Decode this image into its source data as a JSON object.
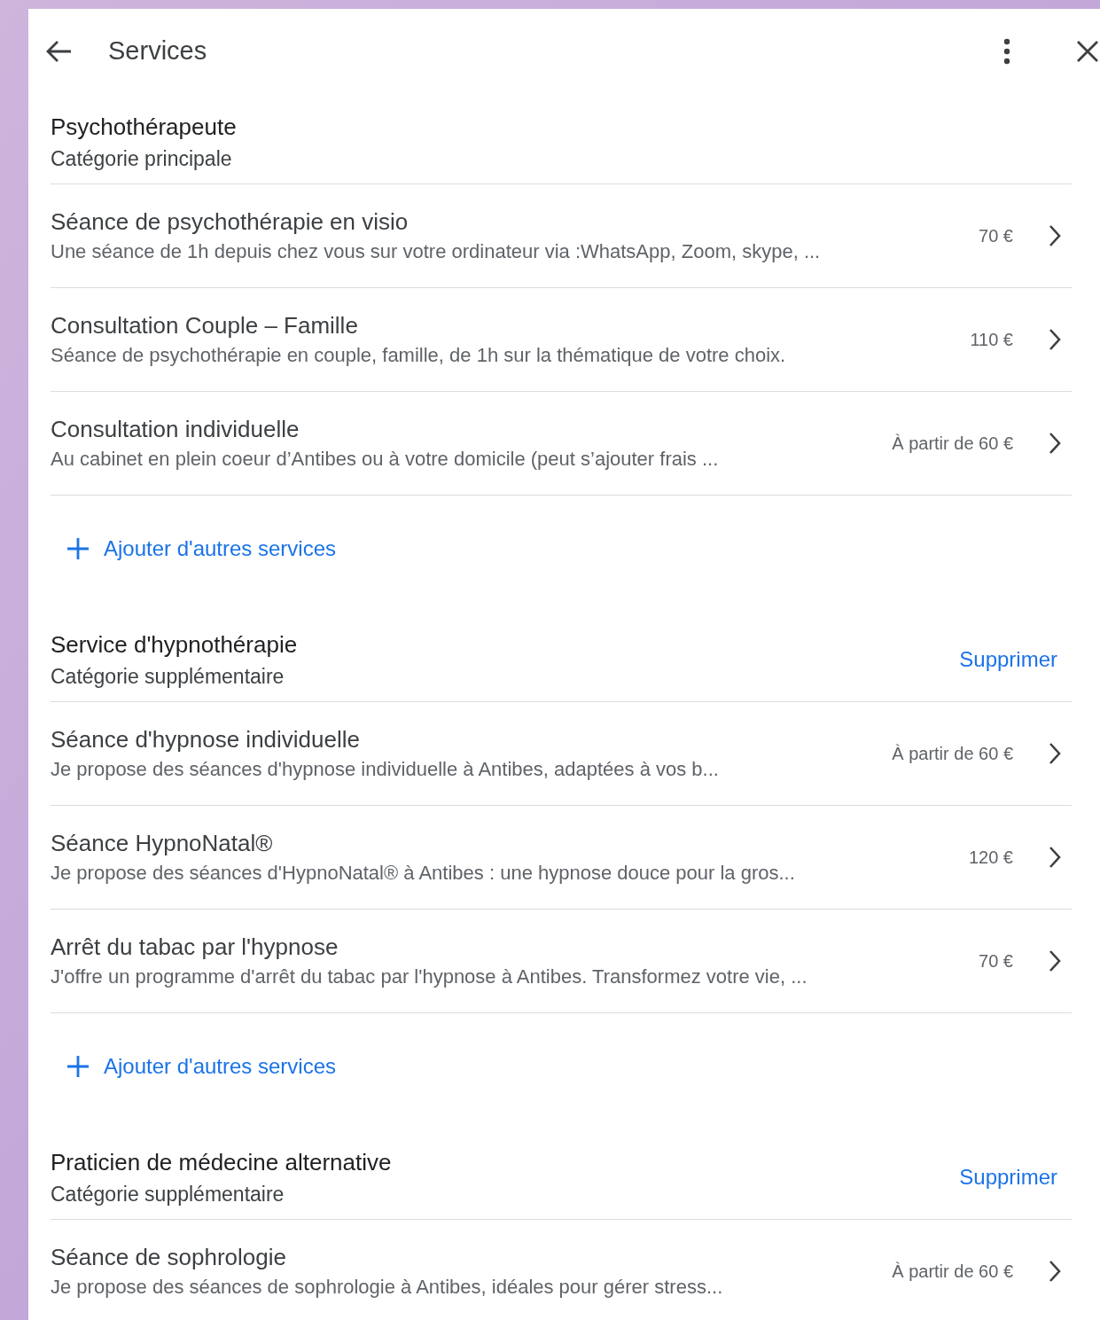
{
  "header": {
    "title": "Services"
  },
  "sections": [
    {
      "title": "Psychothérapeute",
      "subtitle": "Catégorie principale",
      "services": [
        {
          "title": "Séance de psychothérapie en visio",
          "description": "Une séance de 1h depuis chez vous sur votre ordinateur via :WhatsApp, Zoom, skype, ...",
          "price": "70 €"
        },
        {
          "title": "Consultation Couple – Famille",
          "description": "Séance de psychothérapie en couple, famille, de 1h sur la thématique de votre choix.",
          "price": "110 €"
        },
        {
          "title": "Consultation individuelle",
          "description": "Au cabinet en plein coeur d’Antibes ou à votre domicile (peut s’ajouter frais ...",
          "price": "À partir de 60 €"
        }
      ],
      "add_link": "Ajouter d'autres services"
    },
    {
      "title": "Service d'hypnothérapie",
      "subtitle": "Catégorie supplémentaire",
      "action": "Supprimer",
      "services": [
        {
          "title": "Séance d'hypnose individuelle",
          "description": "Je propose des séances d'hypnose individuelle à Antibes, adaptées à vos b...",
          "price": "À partir de 60 €"
        },
        {
          "title": "Séance HypnoNatal®",
          "description": "Je propose des séances d'HypnoNatal® à Antibes : une hypnose douce pour la gros...",
          "price": "120 €"
        },
        {
          "title": "Arrêt du tabac par l'hypnose",
          "description": "J'offre un programme d'arrêt du tabac par l'hypnose à Antibes. Transformez votre vie, ...",
          "price": "70 €"
        }
      ],
      "add_link": "Ajouter d'autres services"
    },
    {
      "title": "Praticien de médecine alternative",
      "subtitle": "Catégorie supplémentaire",
      "action": "Supprimer",
      "services": [
        {
          "title": "Séance de sophrologie",
          "description": "Je propose des séances de sophrologie à Antibes, idéales pour gérer stress...",
          "price": "À partir de 60 €"
        }
      ]
    }
  ]
}
